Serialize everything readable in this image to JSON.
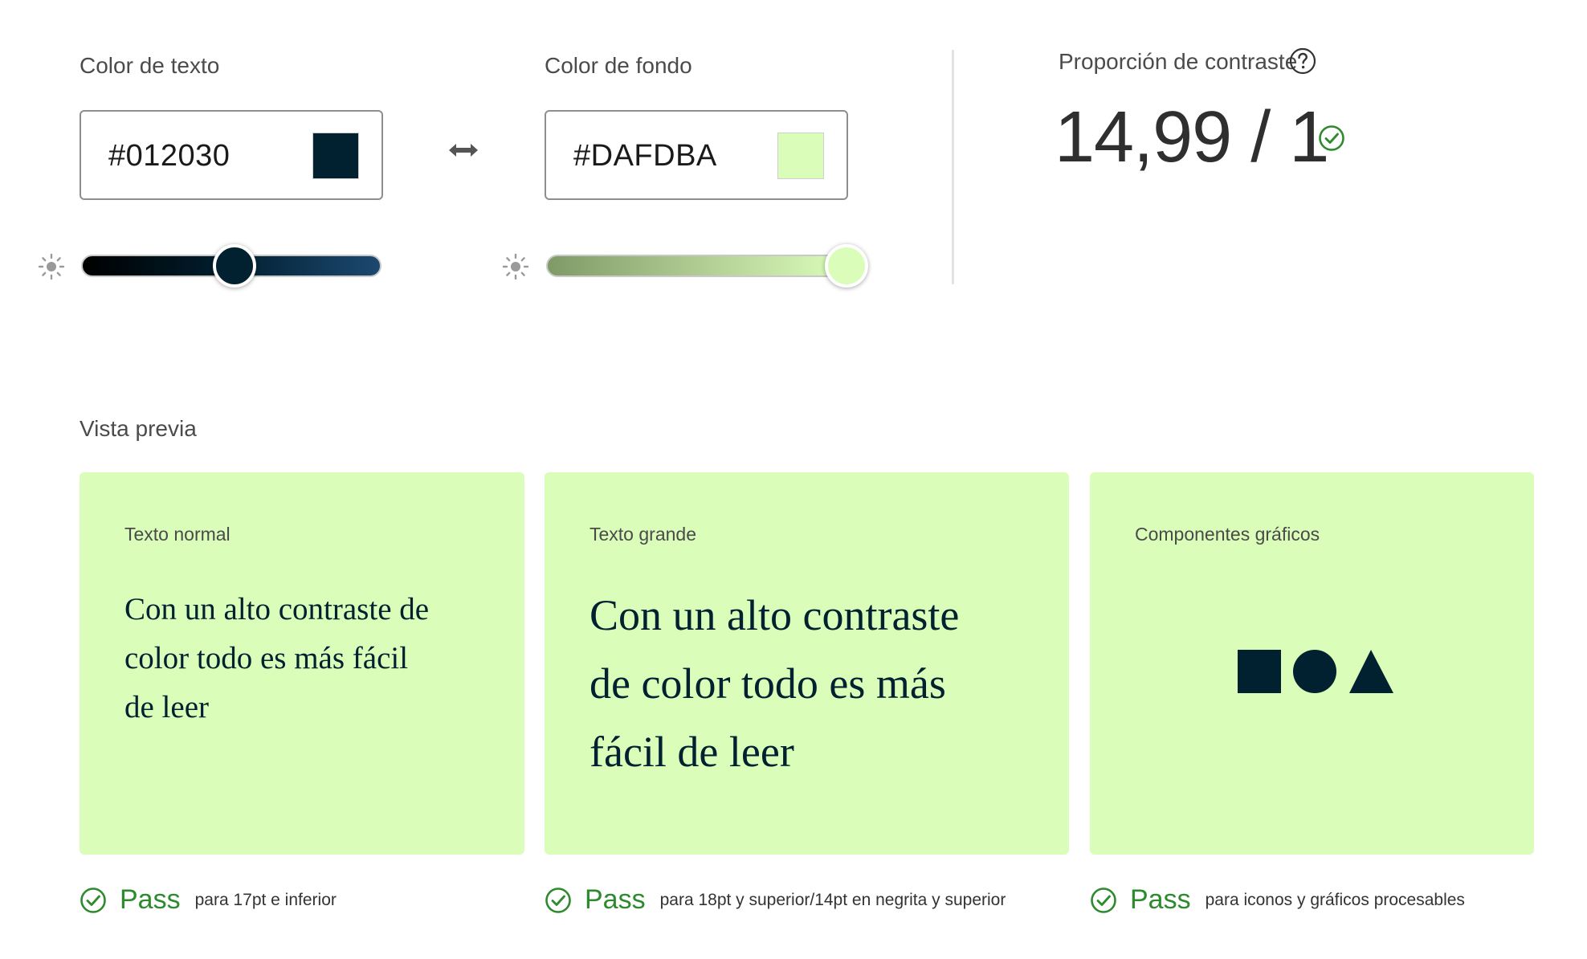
{
  "colors": {
    "text": "#012030",
    "background": "#DAFDBA",
    "pass_green": "#2d8a2d"
  },
  "text_color": {
    "label": "Color de texto",
    "value": "#012030",
    "brightness_slider_fraction": 0.51
  },
  "swap_icon": "swap-horizontal-arrows",
  "background_color": {
    "label": "Color de fondo",
    "value": "#DAFDBA",
    "brightness_slider_fraction": 1.0
  },
  "contrast": {
    "label": "Proporción de contraste",
    "value": "14,99 / 1",
    "help_icon": "question-circle",
    "status_icon": "check-circle"
  },
  "preview": {
    "title": "Vista previa",
    "cards": [
      {
        "title": "Texto normal",
        "lines": [
          "Con un alto contraste de",
          "color todo es más fácil",
          "de leer"
        ],
        "pass_label": "Pass",
        "pass_desc": "para 17pt e inferior"
      },
      {
        "title": "Texto grande",
        "lines": [
          "Con un alto contraste",
          "de color todo es más",
          "fácil de leer"
        ],
        "pass_label": "Pass",
        "pass_desc": "para 18pt y superior/14pt en negrita y superior"
      },
      {
        "title": "Componentes gráficos",
        "shapes": [
          "square",
          "circle",
          "triangle"
        ],
        "pass_label": "Pass",
        "pass_desc": "para iconos y gráficos procesables"
      }
    ]
  }
}
